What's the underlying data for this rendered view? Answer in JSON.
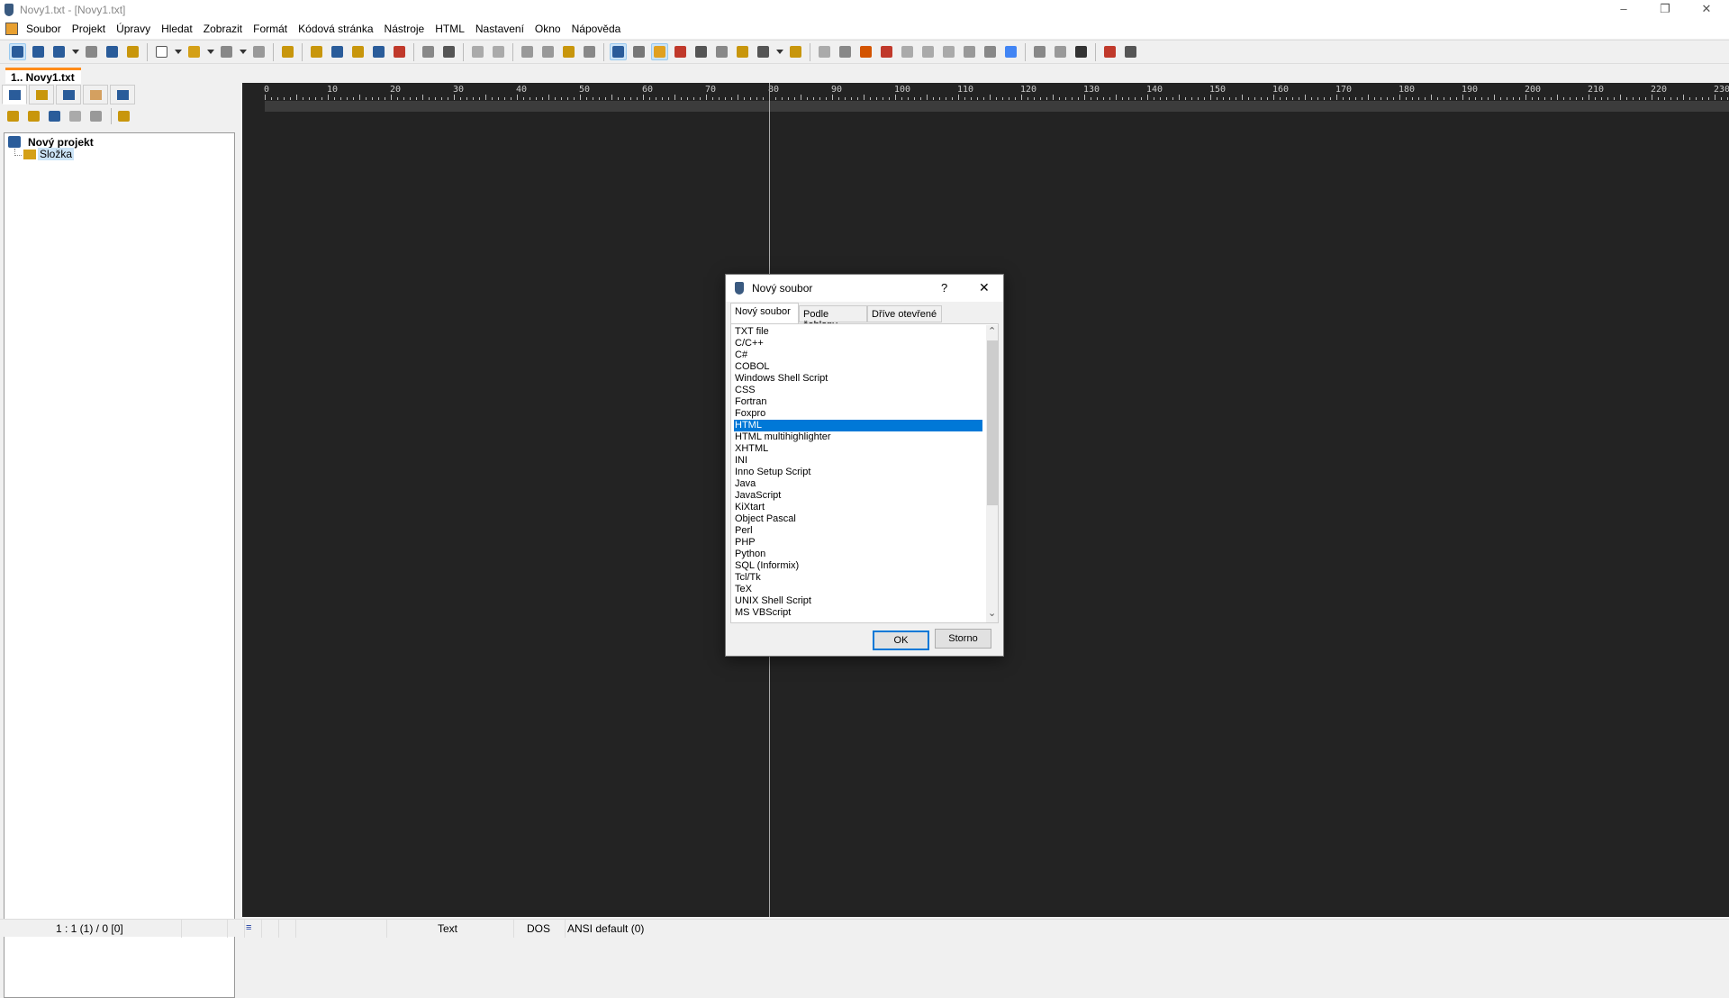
{
  "window": {
    "title": "Novy1.txt - [Novy1.txt]",
    "controls": {
      "minimize": "–",
      "restore": "❐",
      "close": "✕"
    }
  },
  "menu": [
    "Soubor",
    "Projekt",
    "Úpravy",
    "Hledat",
    "Zobrazit",
    "Formát",
    "Kódová stránka",
    "Nástroje",
    "HTML",
    "Nastavení",
    "Okno",
    "Nápověda"
  ],
  "toolbar": [
    {
      "name": "new-project-icon",
      "color": "#2a5c9a",
      "active": true
    },
    {
      "name": "new-file-project-icon",
      "color": "#2a5c9a"
    },
    {
      "name": "open-project-icon",
      "color": "#2a5c9a"
    },
    {
      "name": "dropdown-icon",
      "color": "#333"
    },
    {
      "name": "save-project-icon",
      "color": "#888"
    },
    {
      "name": "log-icon",
      "color": "#2a5c9a"
    },
    {
      "name": "project-settings-icon",
      "color": "#c8960c"
    },
    "|",
    {
      "name": "new-file-icon",
      "color": "#fff"
    },
    {
      "name": "dropdown-icon",
      "color": "#333"
    },
    {
      "name": "open-file-icon",
      "color": "#d4a017"
    },
    {
      "name": "dropdown-icon",
      "color": "#333"
    },
    {
      "name": "save-icon",
      "color": "#888"
    },
    {
      "name": "dropdown-icon",
      "color": "#333"
    },
    {
      "name": "save-all-icon",
      "color": "#999"
    },
    "|",
    {
      "name": "tree-icon",
      "color": "#c8960c"
    },
    "|",
    {
      "name": "find-icon",
      "color": "#c8960c"
    },
    {
      "name": "replace-icon",
      "color": "#2a5c9a"
    },
    {
      "name": "find-in-files-icon",
      "color": "#c8960c"
    },
    {
      "name": "brackets-icon",
      "color": "#2a5c9a"
    },
    {
      "name": "bookmark-icon",
      "color": "#c0392b"
    },
    "|",
    {
      "name": "print-preview-icon",
      "color": "#888"
    },
    {
      "name": "print-icon",
      "color": "#555"
    },
    "|",
    {
      "name": "undo-icon",
      "color": "#aaa"
    },
    {
      "name": "redo-icon",
      "color": "#aaa"
    },
    "|",
    {
      "name": "cut-icon",
      "color": "#999"
    },
    {
      "name": "copy-icon",
      "color": "#999"
    },
    {
      "name": "paste-icon",
      "color": "#c8960c"
    },
    {
      "name": "delete-icon",
      "color": "#888"
    },
    "|",
    {
      "name": "word-wrap-icon",
      "color": "#2a5c9a",
      "active": true
    },
    {
      "name": "pilcrow-icon",
      "color": "#777"
    },
    {
      "name": "highlight-icon",
      "color": "#e0a020",
      "active": true
    },
    {
      "name": "syntax-icon",
      "color": "#c0392b"
    },
    {
      "name": "line-numbers-icon",
      "color": "#555"
    },
    {
      "name": "insert-icon",
      "color": "#888"
    },
    {
      "name": "lock-icon",
      "color": "#c8960c"
    },
    {
      "name": "spell-icon",
      "color": "#555"
    },
    {
      "name": "dropdown-icon",
      "color": "#333"
    },
    {
      "name": "bookmark-arrow-icon",
      "color": "#c8960c"
    },
    "|",
    {
      "name": "indent-icon",
      "color": "#aaa"
    },
    {
      "name": "compare-icon",
      "color": "#888"
    },
    {
      "name": "color-wheel-icon",
      "color": "#d35400"
    },
    {
      "name": "color-code-icon",
      "color": "#c0392b"
    },
    {
      "name": "html-to-text-icon",
      "color": "#aaa"
    },
    {
      "name": "tag-upper-icon",
      "color": "#aaa"
    },
    {
      "name": "tag-lower-icon",
      "color": "#aaa"
    },
    {
      "name": "web-icon",
      "color": "#999"
    },
    {
      "name": "filter-icon",
      "color": "#888"
    },
    {
      "name": "google-icon",
      "color": "#4285f4"
    },
    "|",
    {
      "name": "run-icon",
      "color": "#888"
    },
    {
      "name": "binary-icon",
      "color": "#999"
    },
    {
      "name": "console-icon",
      "color": "#333"
    },
    "|",
    {
      "name": "record-macro-icon",
      "color": "#c0392b"
    },
    {
      "name": "glasses-icon",
      "color": "#555"
    }
  ],
  "document_tab": "1.. Novy1.txt",
  "left_panel": {
    "tabs": [
      {
        "name": "project-tab-icon",
        "color": "#2a5c9a"
      },
      {
        "name": "folder-tab-icon",
        "color": "#c8960c"
      },
      {
        "name": "ftp-tab-icon",
        "color": "#2a5c9a"
      },
      {
        "name": "favorites-tab-icon",
        "color": "#d4a060"
      },
      {
        "name": "windows-tab-icon",
        "color": "#2a5c9a"
      }
    ],
    "tools": [
      {
        "name": "add-folder-icon",
        "color": "#c8960c"
      },
      {
        "name": "remove-folder-icon",
        "color": "#c8960c"
      },
      {
        "name": "add-file-icon",
        "color": "#2a5c9a"
      },
      {
        "name": "remove-file-icon",
        "color": "#aaa"
      },
      {
        "name": "info-icon",
        "color": "#999"
      },
      "|",
      {
        "name": "settings-tools-icon",
        "color": "#c8960c"
      }
    ],
    "tree": {
      "project": "Nový projekt",
      "folder": "Složka"
    }
  },
  "ruler": {
    "labels": [
      0,
      10,
      20,
      30,
      40,
      50,
      60,
      70,
      80,
      90,
      100,
      110,
      120,
      130,
      140,
      150,
      160,
      170,
      180,
      190,
      200,
      210,
      220,
      230
    ]
  },
  "status": {
    "position": "1 : 1 (1) / 0  [0]",
    "mode": "Text",
    "line_ending": "DOS",
    "encoding": "ANSI default (0)"
  },
  "dialog": {
    "title": "Nový soubor",
    "help": "?",
    "close": "✕",
    "tabs": [
      "Nový soubor",
      "Podle šablony",
      "Dříve otevřené"
    ],
    "items": [
      "TXT file",
      "C/C++",
      "C#",
      "COBOL",
      "Windows Shell Script",
      "CSS",
      "Fortran",
      "Foxpro",
      "HTML",
      "HTML multihighlighter",
      "XHTML",
      "INI",
      "Inno Setup Script",
      "Java",
      "JavaScript",
      "KiXtart",
      "Object Pascal",
      "Perl",
      "PHP",
      "Python",
      "SQL (Informix)",
      "Tcl/Tk",
      "TeX",
      "UNIX Shell Script",
      "MS VBScript"
    ],
    "selected": "HTML",
    "ok": "OK",
    "cancel": "Storno",
    "scroll_up": "⌃",
    "scroll_down": "⌄"
  },
  "colors": {
    "accent": "#0078d7",
    "editor_bg": "#232323",
    "tab_accent": "#ff8c1a"
  }
}
